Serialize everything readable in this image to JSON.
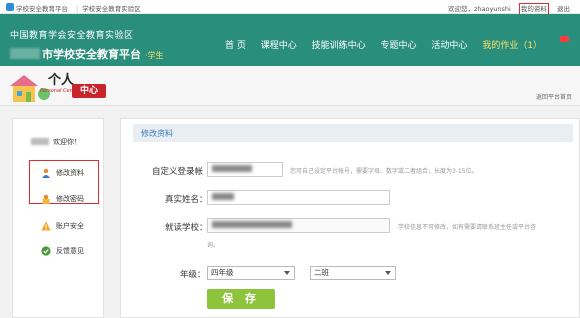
{
  "topbar": {
    "site_name": "学校安全教育平台",
    "experiment_zone": "学校安全教育实验区",
    "welcome": "欢迎您，zhaoyunshi",
    "my_profile": "我的资料",
    "logout": "退出"
  },
  "header": {
    "line1": "中国教育学会安全教育实验区",
    "line2": "市学校安全教育平台",
    "role": "·学生",
    "nav": [
      "首  页",
      "课程中心",
      "技能训练中心",
      "专题中心",
      "活动中心",
      "我的作业（1）"
    ]
  },
  "banner": {
    "title": "个人",
    "tag": "中心",
    "subtitle": "Personal Center",
    "back_link": "返回平台首页"
  },
  "sidebar": {
    "welcome": "欢迎你！",
    "items": [
      {
        "label": "修改资料"
      },
      {
        "label": "修改密码"
      },
      {
        "label": "账户安全"
      },
      {
        "label": "反馈意见"
      }
    ]
  },
  "form": {
    "section_title": "修改资料",
    "custom_account_label": "自定义登录帐",
    "custom_account_hint": "您可自己设定平台帐号，需要字母、数字或二者组合，长度为3-15位。",
    "real_name_label": "真实姓名：",
    "school_label": "就读学校：",
    "school_hint": "学校信息不可修改，如有需要请联系班主任或平台咨",
    "school_hint_2": "询。",
    "grade_label": "年级：",
    "grade_value": "四年级",
    "class_value": "二班",
    "save_label": "保  存"
  },
  "colors": {
    "header_bg": "#2a8e7c",
    "highlight_box": "#d83030",
    "save_button": "#8dc43c",
    "section_title": "#3a7fc1"
  }
}
